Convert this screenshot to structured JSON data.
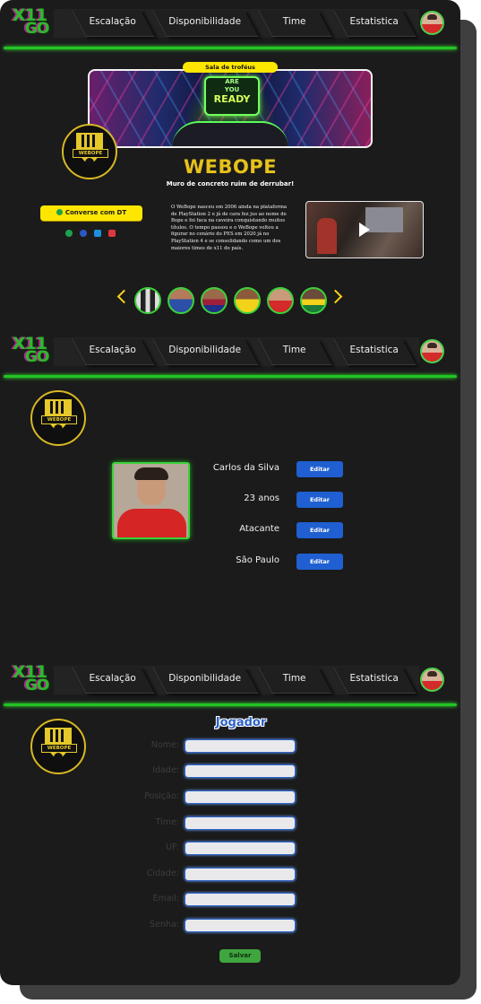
{
  "nav": {
    "logo_line1": "X11",
    "logo_line2": "GO",
    "tabs": [
      "Escalação",
      "Disponibilidade",
      "Time",
      "Estatistica"
    ]
  },
  "profile_page": {
    "trophy_label": "Sala de troféus",
    "banner_text_line1": "ARE",
    "banner_text_line2": "YOU",
    "banner_text_line3": "READY",
    "team_name": "WEBOPE",
    "slogan": "Muro de concreto ruim de derrubar!",
    "crest_text": "WEBOPE",
    "contact_button": "Converse com DT",
    "social_icons": [
      "whatsapp-icon",
      "facebook-icon",
      "twitter-icon",
      "instagram-icon"
    ],
    "about": "O WeBope nasceu em 2006 ainda na plataforma de PlayStation 2 e já de cara fez jus ao nome de Bope e foi faca na caveira conquistando muitos títulos. O tempo passou e o WeBope voltou a figurar no cenário do PES em 2020 já no PlayStation 4 e se consolidando como um dos maiores times de x11 do país.",
    "players_count": 6
  },
  "player_page": {
    "fields": [
      {
        "value": "Carlos da Silva",
        "button": "Editar"
      },
      {
        "value": "23 anos",
        "button": "Editar"
      },
      {
        "value": "Atacante",
        "button": "Editar"
      },
      {
        "value": "São Paulo",
        "button": "Editar"
      }
    ]
  },
  "form_page": {
    "title": "Jogador",
    "labels": [
      "Nome:",
      "Idade:",
      "Posição:",
      "Time:",
      "UF:",
      "Cidade:",
      "Email:",
      "Senha:"
    ],
    "submit": "Salvar"
  },
  "colors": {
    "accent_green": "#22c422",
    "accent_yellow": "#ffe600",
    "button_blue": "#1f5fd1",
    "background": "#1b1b1b"
  }
}
